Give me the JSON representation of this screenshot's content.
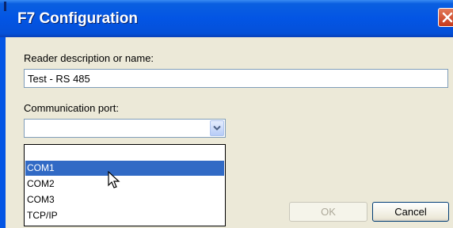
{
  "window": {
    "title": "F7 Configuration"
  },
  "form": {
    "reader_label": "Reader description or name:",
    "reader_value": "Test - RS 485",
    "port_label": "Communication port:",
    "port_value": "",
    "port_options": [
      "",
      "COM1",
      "COM2",
      "COM3",
      "TCP/IP"
    ],
    "selected_option": "COM1"
  },
  "buttons": {
    "ok_label": "OK",
    "cancel_label": "Cancel"
  },
  "colors": {
    "titlebar": "#0355e4",
    "selection": "#316ac5",
    "close": "#c5391b"
  },
  "icons": {
    "close": "close-icon",
    "dropdown": "chevron-down-icon",
    "cursor": "mouse-pointer-icon"
  }
}
